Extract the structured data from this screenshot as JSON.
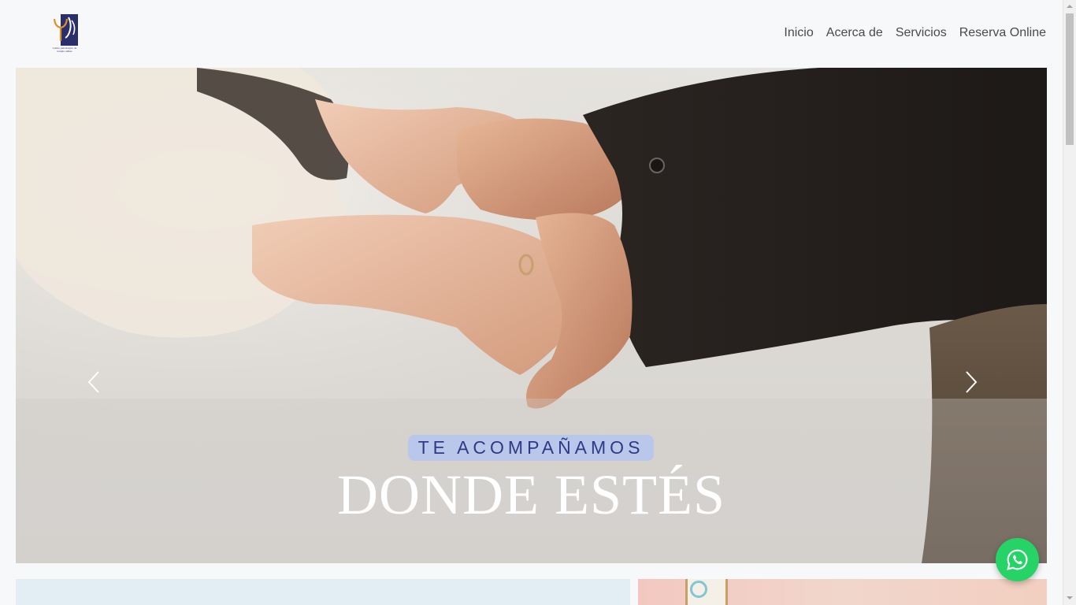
{
  "header": {
    "logo": {
      "text": "Centro psicológico de terapia online",
      "colors": {
        "mark": "#2a2f6b",
        "accent": "#e0902a"
      }
    },
    "nav": [
      {
        "label": "Inicio"
      },
      {
        "label": "Acerca de"
      },
      {
        "label": "Servicios"
      },
      {
        "label": "Reserva Online"
      }
    ]
  },
  "hero": {
    "eyebrow": "TE ACOMPAÑAMOS",
    "headline": "DONDE ESTÉS",
    "prev_icon": "chevron-left-icon",
    "next_icon": "chevron-right-icon",
    "colors": {
      "eyebrow_bg": "#b9c8ea",
      "eyebrow_text": "#2e3a86",
      "headline": "#ffffff"
    }
  },
  "floating": {
    "whatsapp_icon": "whatsapp-icon",
    "color": "#25d366"
  }
}
